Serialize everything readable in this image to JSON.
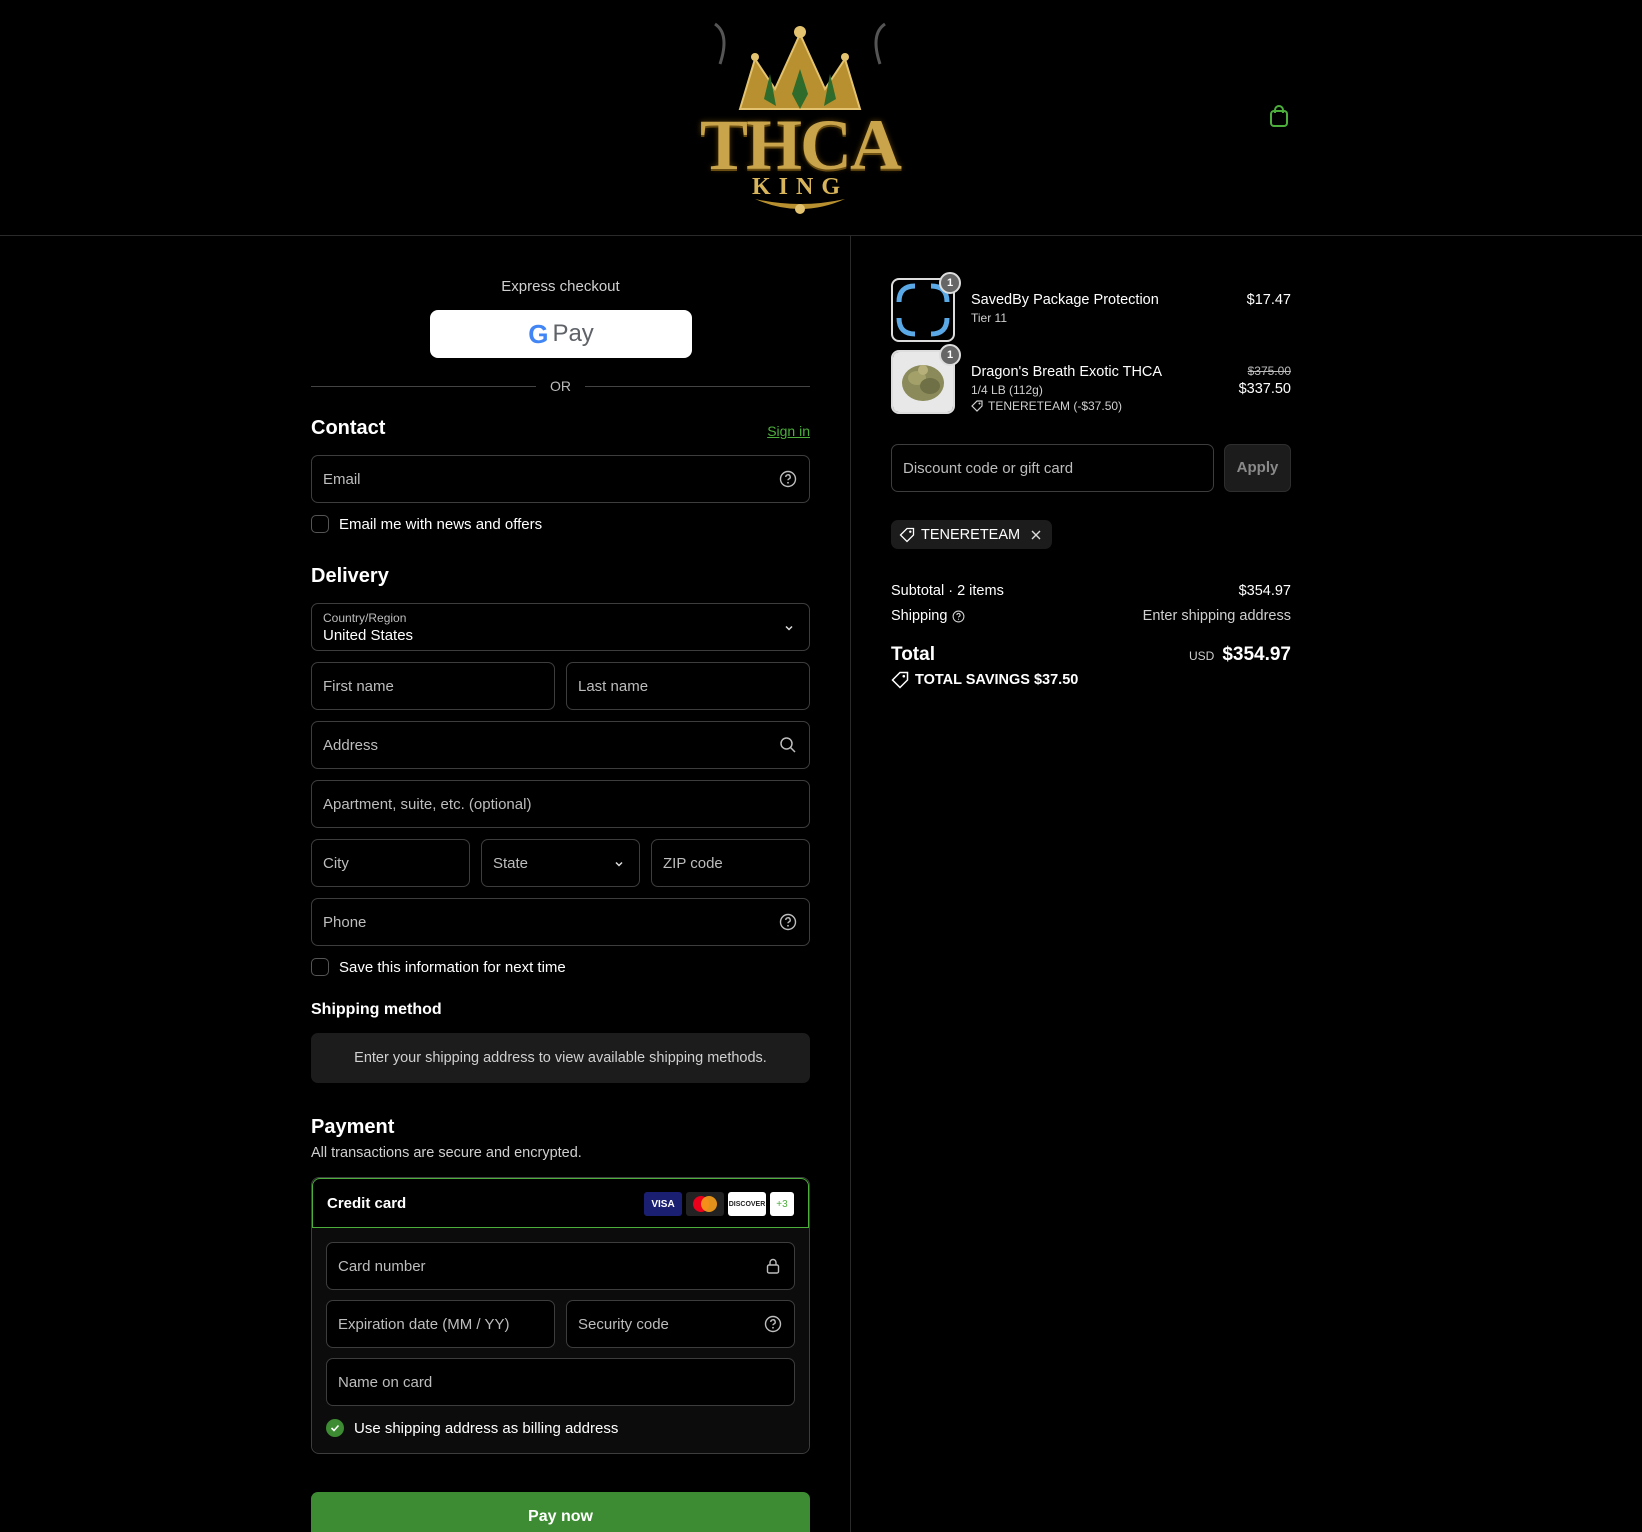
{
  "brand": {
    "logo_main": "THCA",
    "logo_sub": "KING"
  },
  "header": {
    "cart_icon": "shopping-bag-icon"
  },
  "express": {
    "title": "Express checkout",
    "gpay_g": "G",
    "gpay_pay": "Pay",
    "or": "OR"
  },
  "contact": {
    "title": "Contact",
    "sign_in": "Sign in",
    "email_placeholder": "Email",
    "news_label": "Email me with news and offers"
  },
  "delivery": {
    "title": "Delivery",
    "country_label": "Country/Region",
    "country_value": "United States",
    "first_name": "First name",
    "last_name": "Last name",
    "address": "Address",
    "apartment": "Apartment, suite, etc. (optional)",
    "city": "City",
    "state": "State",
    "zip": "ZIP code",
    "phone": "Phone",
    "save_label": "Save this information for next time"
  },
  "shipping_method": {
    "title": "Shipping method",
    "message": "Enter your shipping address to view available shipping methods."
  },
  "payment": {
    "title": "Payment",
    "subtitle": "All transactions are secure and encrypted.",
    "method_label": "Credit card",
    "logos": [
      "VISA",
      "",
      "DISCOVER",
      "+3"
    ],
    "card_number": "Card number",
    "expiration": "Expiration date (MM / YY)",
    "security_code": "Security code",
    "name_on_card": "Name on card",
    "billing_label": "Use shipping address as billing address",
    "pay_now": "Pay now"
  },
  "order": {
    "items": [
      {
        "qty": "1",
        "name": "SavedBy Package Protection",
        "meta": "Tier 11",
        "price": "$17.47"
      },
      {
        "qty": "1",
        "name": "Dragon's Breath Exotic THCA",
        "meta": "1/4 LB (112g)",
        "discount": "TENERETEAM (-$37.50)",
        "old_price": "$375.00",
        "price": "$337.50"
      }
    ],
    "discount_placeholder": "Discount code or gift card",
    "apply": "Apply",
    "applied_code": "TENERETEAM",
    "subtotal_label": "Subtotal · 2 items",
    "subtotal_value": "$354.97",
    "shipping_label": "Shipping",
    "shipping_value": "Enter shipping address",
    "total_label": "Total",
    "currency": "USD",
    "total_value": "$354.97",
    "savings": "TOTAL SAVINGS $37.50"
  },
  "colors": {
    "accent": "#3d8b32",
    "link": "#4caf3c",
    "background": "#000000"
  }
}
